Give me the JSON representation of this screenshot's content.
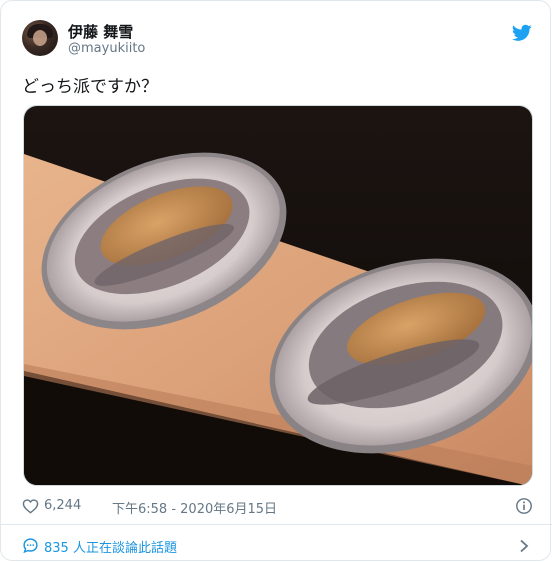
{
  "author": {
    "name": "伊藤 舞雪",
    "handle": "@mayukiito"
  },
  "tweet": {
    "text": "どっち派ですか？"
  },
  "footer": {
    "likes": "6,244",
    "timestamp": "下午6:58 - 2020年6月15日"
  },
  "conversation": {
    "text": "835 人正在談論此話題"
  },
  "colors": {
    "link": "#1b95e0",
    "muted": "#657786",
    "text": "#14171a",
    "border": "#e1e8ed"
  },
  "icons": [
    "twitter-bird-icon",
    "heart-icon",
    "info-icon",
    "speech-bubble-icon",
    "chevron-right-icon"
  ]
}
